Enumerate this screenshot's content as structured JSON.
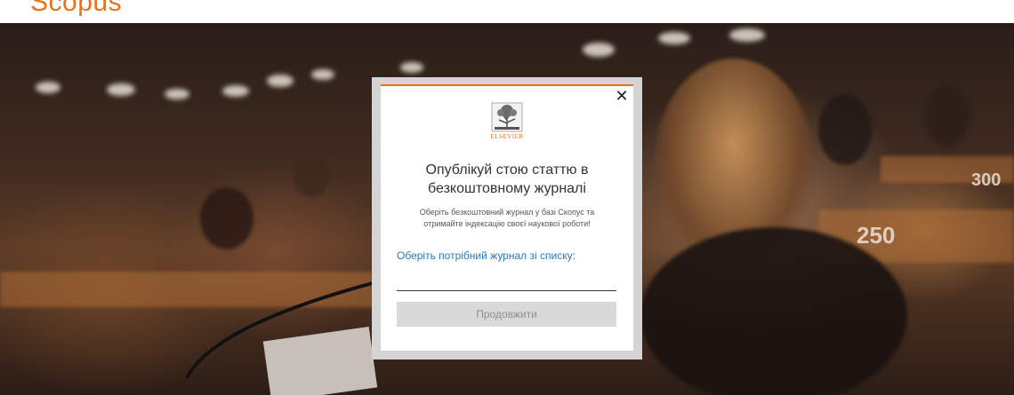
{
  "header": {
    "logo_text": "Scopus",
    "accent_color": "#e9711c"
  },
  "hero": {
    "description_icon": "conference-hall-photo",
    "signs": [
      "250",
      "300"
    ]
  },
  "modal": {
    "close_label": "✕",
    "brand_name": "ELSEVIER",
    "brand_icon": "elsevier-tree-logo-icon",
    "title_line1": "Опублікуй стою статтю в",
    "title_line2": "безкоштовному журналі",
    "subtitle_line1": "Оберіть безкоштовний журнал у базі Скопус та",
    "subtitle_line2": "отримайте індексацію своєї наукової роботи!",
    "select_label": "Оберіть потрібний журнал зі списку:",
    "input_value": "",
    "continue_label": "Продовжити",
    "label_color": "#2a78b4"
  }
}
